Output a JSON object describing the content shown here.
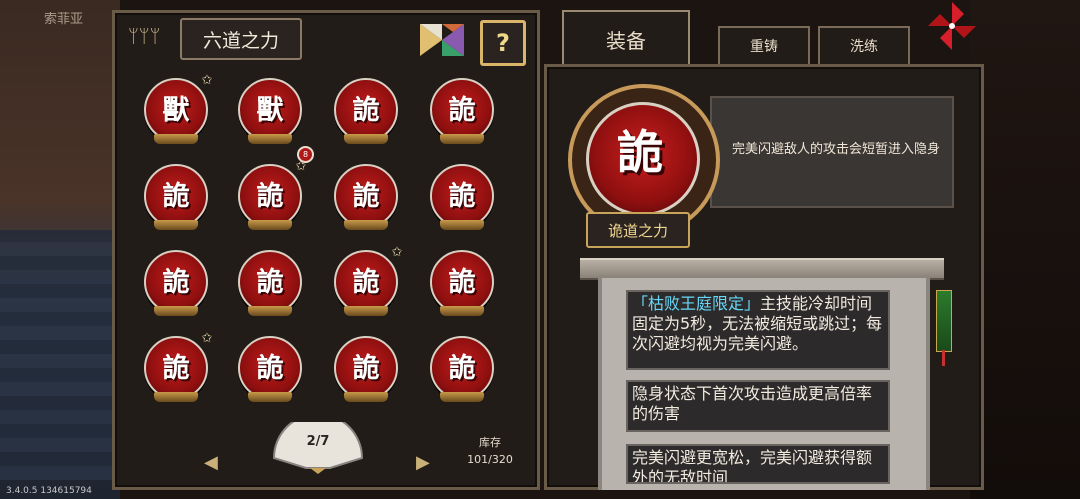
{
  "background": {
    "top_left_text": "索菲亚",
    "version": "3.4.0.5 134615794"
  },
  "left_panel": {
    "title": "六道之力",
    "help_label": "?",
    "orbs": [
      {
        "glyph": "獸",
        "star": true,
        "badge": ""
      },
      {
        "glyph": "獸",
        "star": false,
        "badge": ""
      },
      {
        "glyph": "詭",
        "star": false,
        "badge": ""
      },
      {
        "glyph": "詭",
        "star": false,
        "badge": ""
      },
      {
        "glyph": "詭",
        "star": false,
        "badge": ""
      },
      {
        "glyph": "詭",
        "star": true,
        "badge": "8"
      },
      {
        "glyph": "詭",
        "star": false,
        "badge": ""
      },
      {
        "glyph": "詭",
        "star": false,
        "badge": ""
      },
      {
        "glyph": "詭",
        "star": false,
        "badge": ""
      },
      {
        "glyph": "詭",
        "star": false,
        "badge": ""
      },
      {
        "glyph": "詭",
        "star": true,
        "badge": ""
      },
      {
        "glyph": "詭",
        "star": false,
        "badge": ""
      },
      {
        "glyph": "詭",
        "star": true,
        "badge": ""
      },
      {
        "glyph": "詭",
        "star": false,
        "badge": ""
      },
      {
        "glyph": "詭",
        "star": false,
        "badge": ""
      },
      {
        "glyph": "詭",
        "star": false,
        "badge": ""
      }
    ],
    "page_indicator": "2/7",
    "storage_label": "库存",
    "storage_value": "101/320"
  },
  "tabs": {
    "active": "装备",
    "reforge": "重铸",
    "refine": "洗练"
  },
  "detail": {
    "glyph": "詭",
    "description": "完美闪避敌人的攻击会短暂进入隐身",
    "name": "诡道之力",
    "entries": [
      {
        "highlight": "「枯败王庭限定」",
        "text": "主技能冷却时间固定为5秒，无法被缩短或跳过；每次闪避均视为完美闪避。"
      },
      {
        "highlight": "",
        "text": "隐身状态下首次攻击造成更高倍率的伤害"
      },
      {
        "highlight": "",
        "text": "完美闪避更宽松，完美闪避获得额外的无敌时间"
      }
    ]
  },
  "colors": {
    "accent_gold": "#c8a45a",
    "orb_red": "#b01818",
    "highlight_cyan": "#68d8f8"
  }
}
